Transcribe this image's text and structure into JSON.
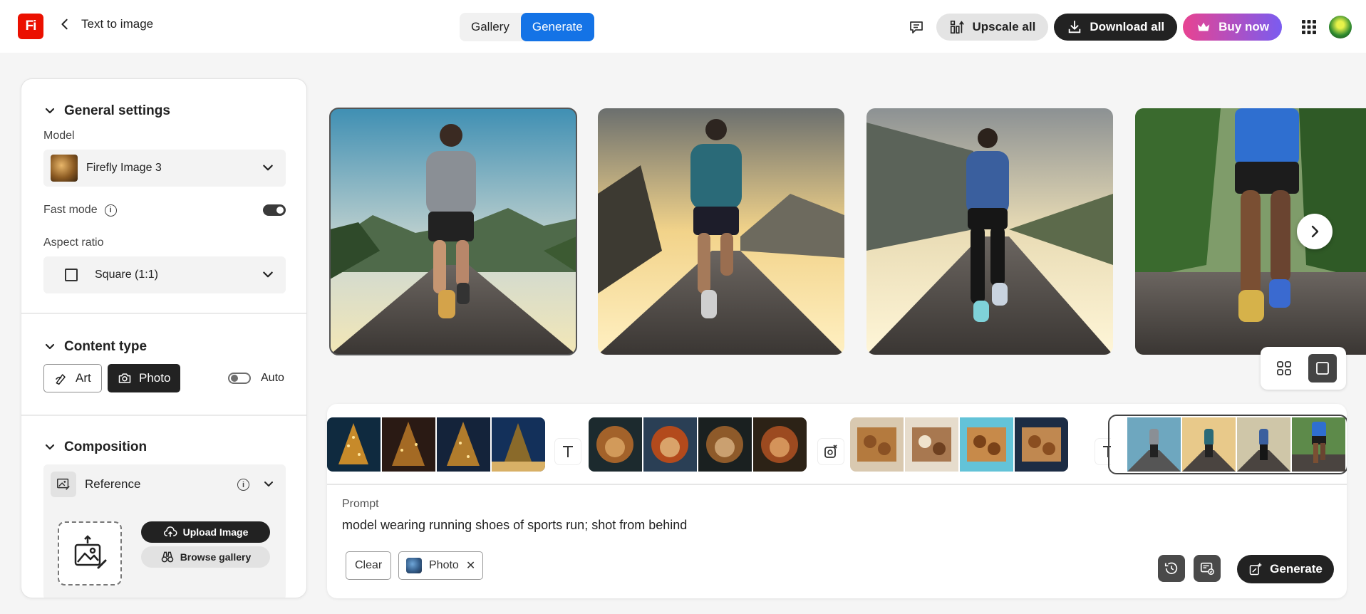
{
  "header": {
    "logo": "Fi",
    "back_label": "Text to image",
    "tabs": [
      {
        "label": "Gallery"
      },
      {
        "label": "Generate"
      }
    ],
    "upscale_label": "Upscale all",
    "download_label": "Download all",
    "buy_label": "Buy now"
  },
  "sidebar": {
    "general": {
      "title": "General settings",
      "model_label": "Model",
      "model_value": "Firefly Image 3",
      "fast_mode_label": "Fast mode",
      "fast_mode_on": true,
      "aspect_label": "Aspect ratio",
      "aspect_value": "Square (1:1)"
    },
    "content_type": {
      "title": "Content type",
      "art_label": "Art",
      "photo_label": "Photo",
      "selected": "Photo",
      "auto_label": "Auto",
      "auto_on": false
    },
    "composition": {
      "title": "Composition",
      "reference_label": "Reference",
      "upload_label": "Upload Image",
      "browse_label": "Browse gallery"
    }
  },
  "main": {
    "images": [
      {
        "subject": "man running on mountain road",
        "selected": true
      },
      {
        "subject": "man running at sunset",
        "selected": false
      },
      {
        "subject": "woman running on road",
        "selected": false
      },
      {
        "subject": "runner legs close-up",
        "selected": false
      }
    ],
    "view_modes": [
      "grid",
      "single"
    ],
    "active_view": "single"
  },
  "history": {
    "groups": [
      {
        "theme": "christmas trees",
        "icon": "text-icon"
      },
      {
        "theme": "lions",
        "icon": "text-icon"
      },
      {
        "theme": "cookies in boxes",
        "icon": "generative-image-icon"
      },
      {
        "theme": "runners",
        "icon": "text-icon",
        "selected": true
      }
    ]
  },
  "prompt": {
    "label": "Prompt",
    "text": "model wearing running shoes of sports run; shot from behind",
    "clear_label": "Clear",
    "chip_label": "Photo",
    "generate_label": "Generate"
  },
  "colors": {
    "accent": "#1473e6",
    "logo": "#eb1000",
    "dark": "#222222"
  }
}
